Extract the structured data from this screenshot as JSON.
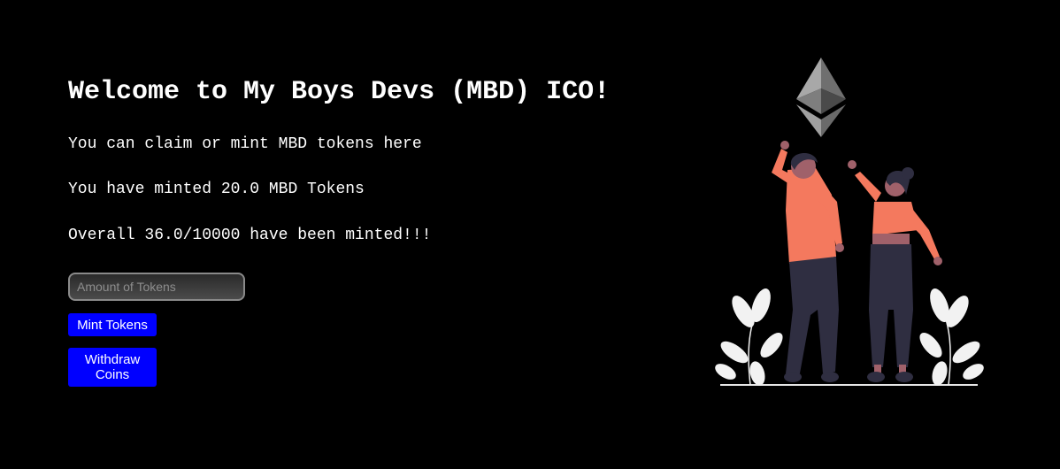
{
  "header": {
    "title": "Welcome to My Boys Devs (MBD) ICO!"
  },
  "info": {
    "intro": "You can claim or mint MBD tokens here",
    "minted_by_user": "You have minted 20.0 MBD Tokens",
    "overall_minted": "Overall 36.0/10000 have been minted!!!"
  },
  "form": {
    "amount_placeholder": "Amount of Tokens",
    "amount_value": "",
    "mint_label": "Mint Tokens",
    "withdraw_label": "Withdraw Coins"
  },
  "colors": {
    "background": "#000000",
    "button": "#0000ff",
    "shirt": "#f4795e",
    "pants": "#2f2e41",
    "leaves": "#f2f2f2",
    "ethereum": "#8c8c8c"
  },
  "icons": {
    "ethereum": "ethereum-logo-icon"
  }
}
